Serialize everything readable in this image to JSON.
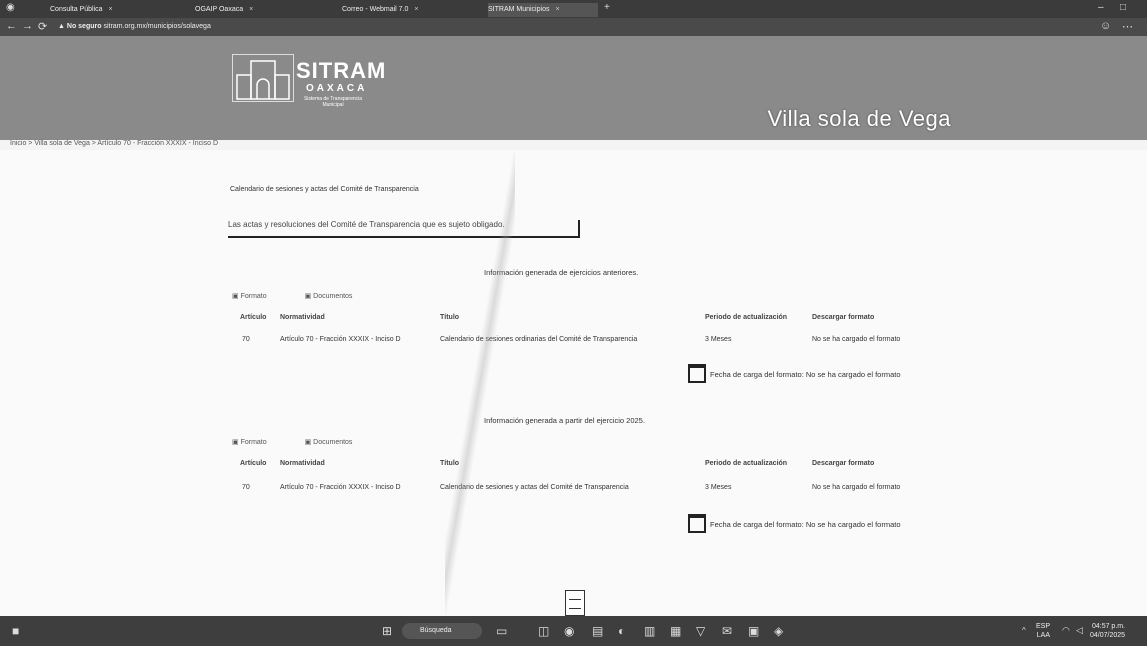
{
  "browser": {
    "tabs": [
      {
        "label": "Consulta Pública"
      },
      {
        "label": "OGAIP Oaxaca"
      },
      {
        "label": "Correo - Webmail 7.0"
      },
      {
        "label": "SITRAM Municipios"
      }
    ],
    "url_prefix": "No seguro",
    "url": "sitram.org.mx/municipios/solavega"
  },
  "header": {
    "logo_title": "SITRAM",
    "logo_subtitle": "OAXACA",
    "logo_caption": "Sistema de Transparencia Municipal",
    "municipality": "Villa sola de Vega"
  },
  "breadcrumb": "Inicio  >  Villa sola de Vega  >  Artículo 70 - Fracción XXXIX - Inciso D",
  "page": {
    "section_title": "Calendario de sesiones y actas del Comité de Transparencia",
    "notice": "Las actas y resoluciones del Comité de Transparencia que es sujeto obligado."
  },
  "blocks": [
    {
      "info_head": "Información generada de ejercicios anteriores.",
      "links": [
        "Formato",
        "Documentos"
      ],
      "columns": [
        "Artículo",
        "Normatividad",
        "Título",
        "Periodo de actualización",
        "Descargar formato"
      ],
      "row": [
        "70",
        "Artículo 70 - Fracción XXXIX - Inciso D",
        "Calendario de sesiones ordinarias del Comité de Transparencia",
        "3 Meses",
        "No se ha cargado el formato"
      ],
      "fecha": "Fecha de carga del formato: No se ha cargado el formato"
    },
    {
      "info_head": "Información generada a partir del ejercicio 2025.",
      "links": [
        "Formato",
        "Documentos"
      ],
      "columns": [
        "Artículo",
        "Normatividad",
        "Título",
        "Periodo de actualización",
        "Descargar formato"
      ],
      "row": [
        "70",
        "Artículo 70 - Fracción XXXIX - Inciso D",
        "Calendario de sesiones y actas del Comité de Transparencia",
        "3 Meses",
        "No se ha cargado el formato"
      ],
      "fecha": "Fecha de carga del formato: No se ha cargado el formato"
    }
  ],
  "taskbar": {
    "search_placeholder": "Búsqueda",
    "lang": "ESP",
    "lang2": "LAA",
    "time": "04:57 p.m.",
    "date": "04/07/2025"
  }
}
